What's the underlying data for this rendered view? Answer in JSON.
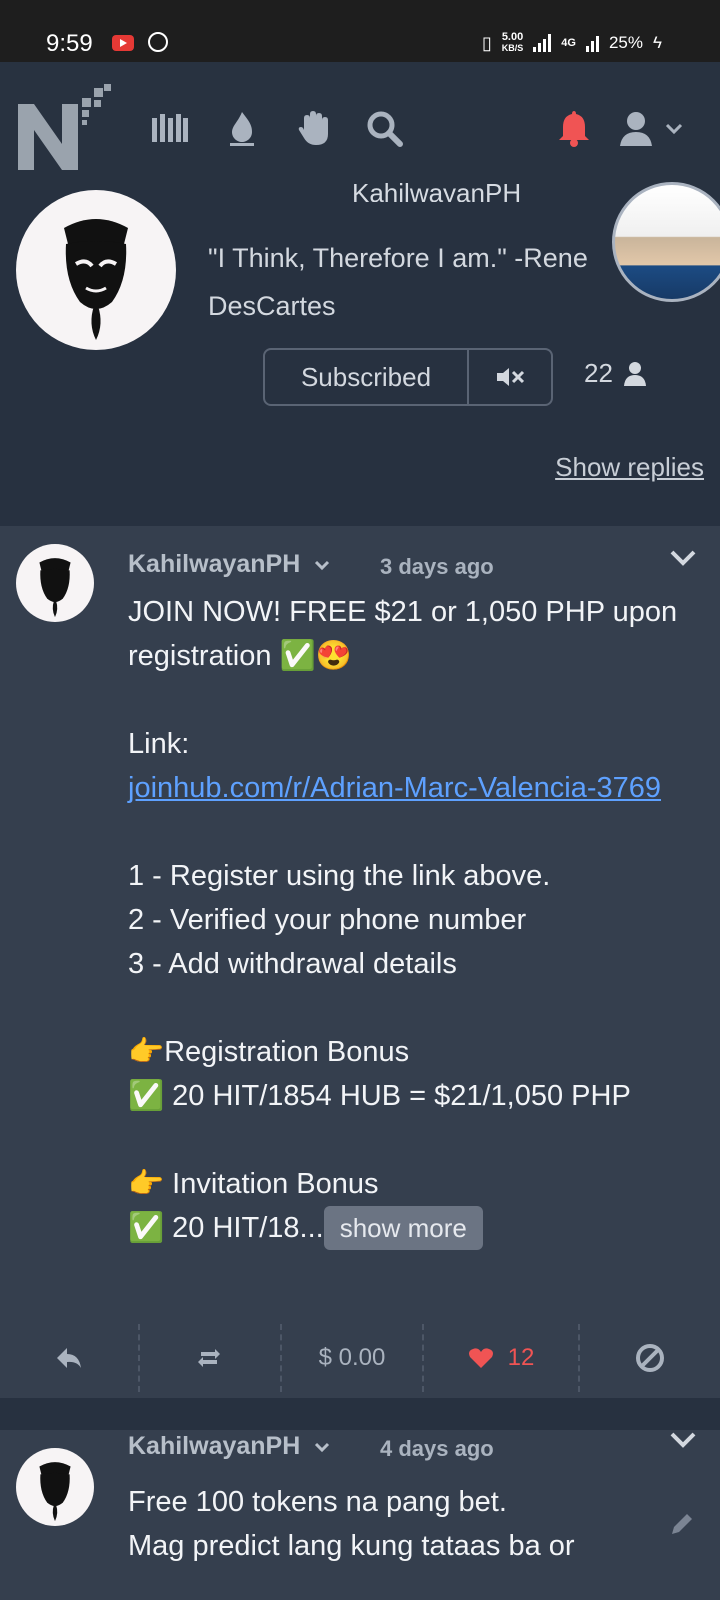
{
  "status_bar": {
    "time": "9:59",
    "net_speed_value": "5.00",
    "net_speed_unit": "KB/S",
    "network_label": "4G",
    "battery": "25%"
  },
  "nav": {
    "logo_letter": "N",
    "icons": [
      "library-icon",
      "fire-icon",
      "hand-icon",
      "search-icon",
      "bell-icon",
      "user-icon",
      "chevron-down-icon"
    ],
    "bell_color": "#f05454"
  },
  "channel": {
    "name": "KahilwayanPH",
    "description": "\"I Think, Therefore I am.\" -Rene DesCartes",
    "subscribe_label": "Subscribed",
    "subscriber_count": "22",
    "show_replies": "Show replies"
  },
  "posts": [
    {
      "author": "KahilwayanPH",
      "time": "3 days ago",
      "line1": "JOIN NOW! FREE $21 or 1,050 PHP upon registration ✅😍",
      "link_label": "Link:",
      "link": "joinhub.com/r/Adrian-Marc-Valencia-3769",
      "steps": "1 - Register using the link above.\n2 - Verified your phone number\n3 - Add withdrawal details",
      "bonus1": "👉Registration Bonus\n✅ 20 HIT/1854 HUB = $21/1,050 PHP",
      "bonus2_title": "👉 Invitation Bonus",
      "bonus2_truncated": "✅ 20 HIT/18...",
      "show_more": "show more",
      "payout": "$ 0.00",
      "likes": "12"
    },
    {
      "author": "KahilwayanPH",
      "time": "4 days ago",
      "text": "Free 100 tokens na pang bet.\nMag predict lang kung tataas ba or"
    }
  ],
  "colors": {
    "background": "#1f2733",
    "post_bg": "#353f4e",
    "link": "#5ea1ff",
    "heart": "#f05454"
  }
}
